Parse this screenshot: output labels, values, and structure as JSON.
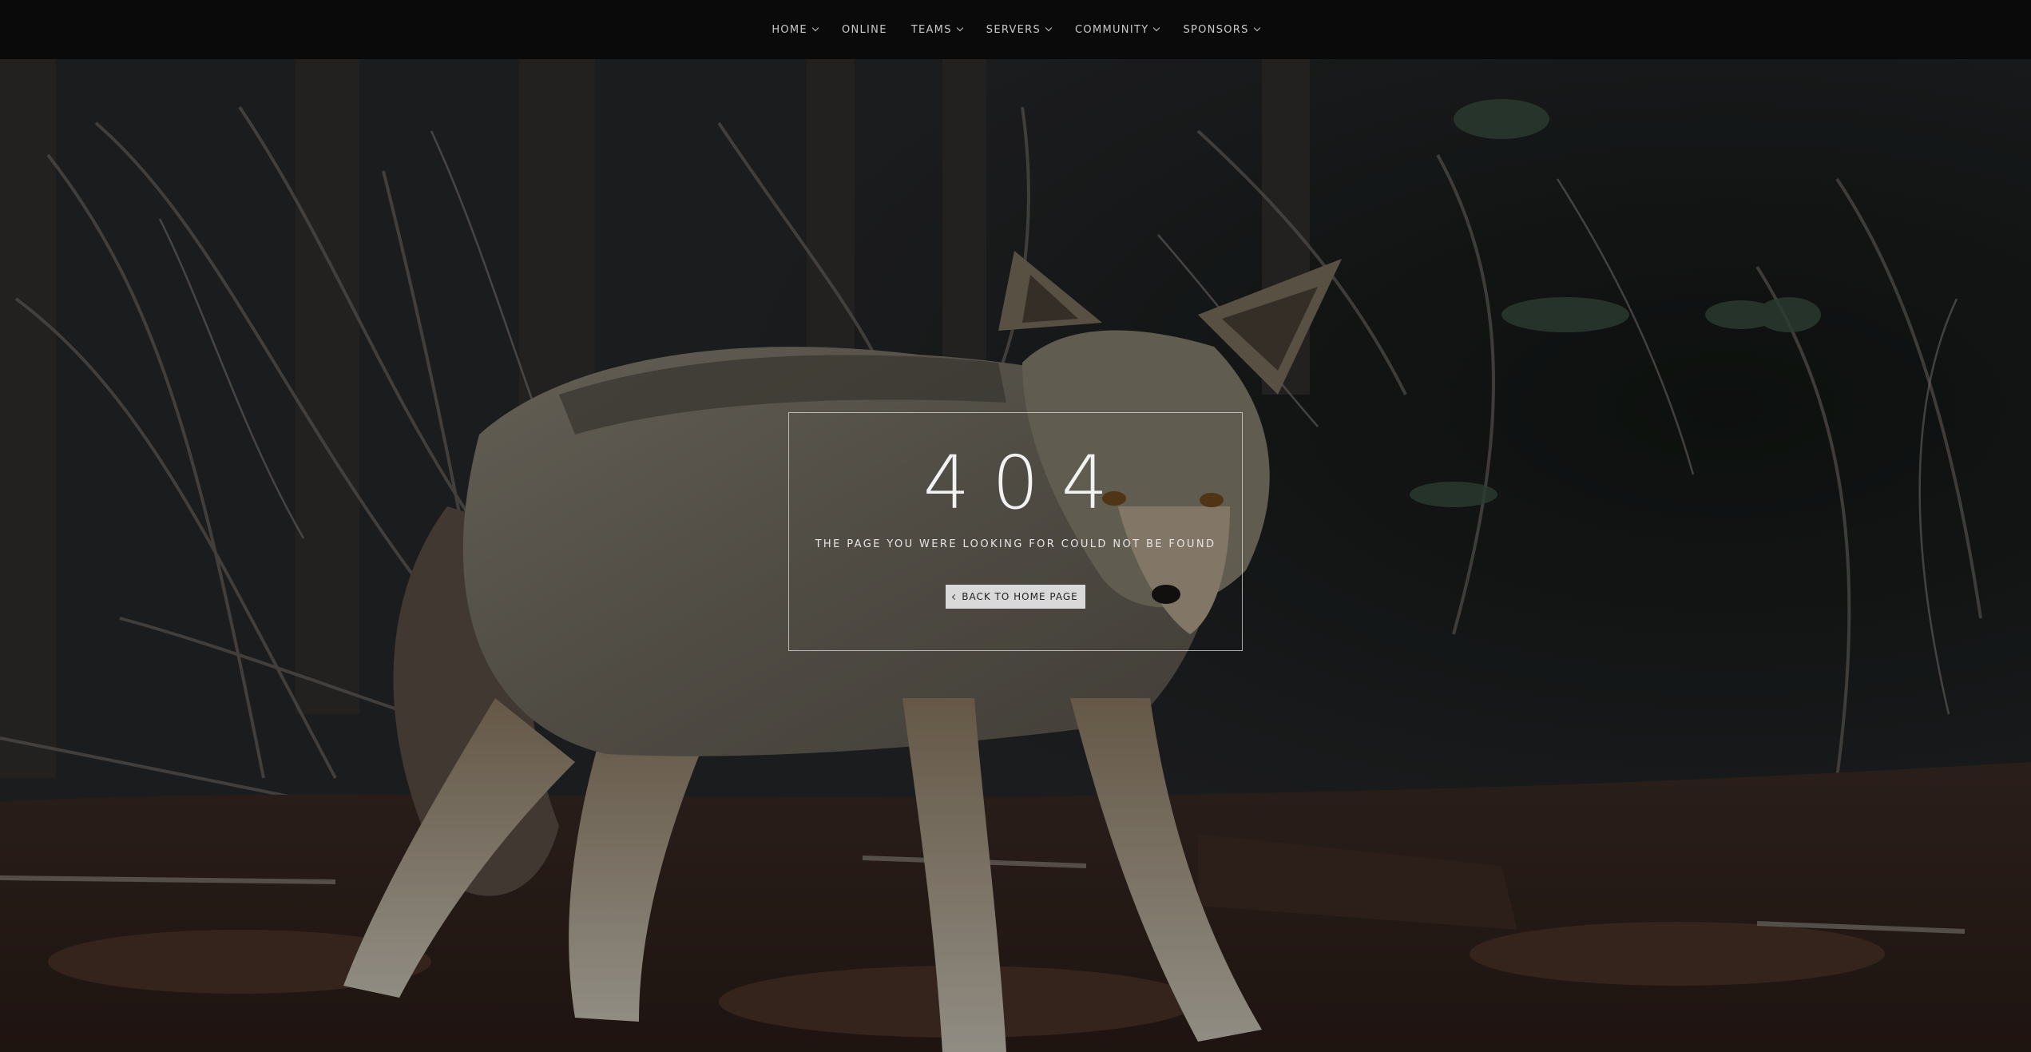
{
  "nav": {
    "items": [
      {
        "label": "HOME",
        "has_dropdown": true
      },
      {
        "label": "ONLINE",
        "has_dropdown": false
      },
      {
        "label": "TEAMS",
        "has_dropdown": true
      },
      {
        "label": "SERVERS",
        "has_dropdown": true
      },
      {
        "label": "COMMUNITY",
        "has_dropdown": true
      },
      {
        "label": "SPONSORS",
        "has_dropdown": true
      }
    ]
  },
  "error": {
    "code": "404",
    "message": "THE PAGE YOU WERE LOOKING FOR COULD NOT BE FOUND",
    "back_button_label": "BACK TO HOME PAGE"
  },
  "background": {
    "subject": "coyote-in-forest-photo"
  },
  "colors": {
    "navbar": "#0a0a0a",
    "nav_text": "#c9c9c9",
    "button_bg": "#d9d9d9",
    "box_border": "#dcdcdc"
  }
}
